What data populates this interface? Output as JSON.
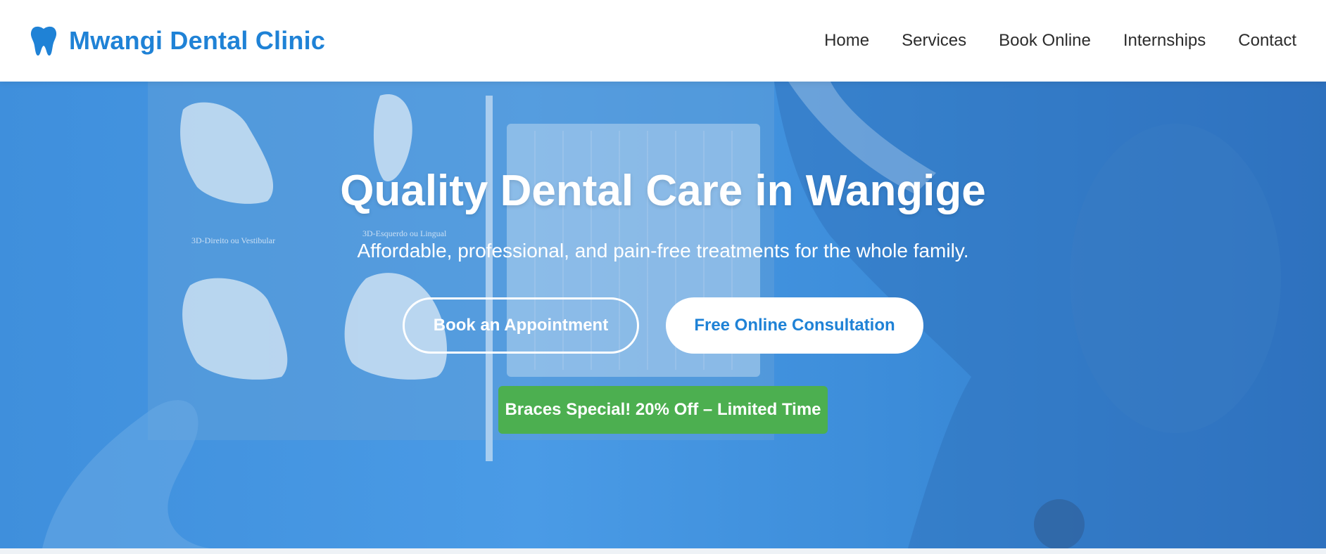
{
  "header": {
    "brand": {
      "icon": "tooth-icon",
      "name": "Mwangi Dental Clinic",
      "color": "#1f82d6"
    },
    "nav": [
      {
        "label": "Home"
      },
      {
        "label": "Services"
      },
      {
        "label": "Book Online"
      },
      {
        "label": "Internships"
      },
      {
        "label": "Contact"
      }
    ]
  },
  "hero": {
    "title": "Quality Dental Care in Wangige",
    "subtitle": "Affordable, professional, and pain-free treatments for the whole family.",
    "primary_button": "Book an Appointment",
    "secondary_button": "Free Online Consultation",
    "promo": "Braces Special! 20% Off – Limited Time",
    "overlay_color": "#4a9be6",
    "promo_color": "#4caf50",
    "xray_labels": [
      "3D-Direito ou Vestibular",
      "3D-Esquerdo ou Lingual"
    ]
  }
}
